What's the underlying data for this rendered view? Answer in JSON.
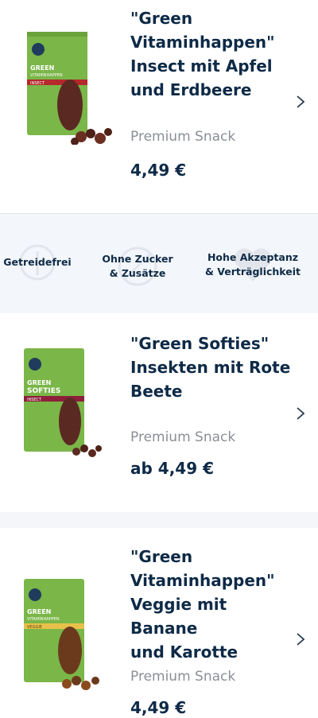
{
  "products": [
    {
      "name_lines": [
        "\"Green",
        "Vitaminhappen\"",
        "Insect mit Apfel",
        "und Erdbeere"
      ],
      "category": "Premium Snack",
      "price": "4,49 €",
      "pack": {
        "line1": "GREEN",
        "line2": "VITAMINHAPPEN",
        "variant": "INSECT",
        "band_color": "#b5282c"
      }
    },
    {
      "name_lines": [
        "\"Green Softies\"",
        "Insekten mit Rote",
        "Beete"
      ],
      "category": "Premium Snack",
      "price": "ab 4,49 €",
      "pack": {
        "line1": "GREEN",
        "line2": "SOFTIES",
        "variant": "INSECT",
        "band_color": "#8e1f3a"
      }
    },
    {
      "name_lines": [
        "\"Green",
        "Vitaminhappen\"",
        "Veggie mit Banane",
        "und Karotte"
      ],
      "category": "Premium Snack",
      "price": "4,49 €",
      "pack": {
        "line1": "GREEN",
        "line2": "VITAMINHAPPEN",
        "variant": "VEGGIE",
        "band_color": "#e8c14a"
      }
    }
  ],
  "features": [
    {
      "lines": [
        "Getreidefrei"
      ],
      "icon": "grain-icon"
    },
    {
      "lines": [
        "Ohne Zucker",
        "& Zusätze"
      ],
      "icon": "no-sugar-icon"
    },
    {
      "lines": [
        "Hohe Akzeptanz",
        "& Verträglichkeit"
      ],
      "icon": "heart-icon"
    }
  ],
  "colors": {
    "text": "#0e2a47",
    "muted": "#8a8f96",
    "pack_green": "#7ab648"
  }
}
